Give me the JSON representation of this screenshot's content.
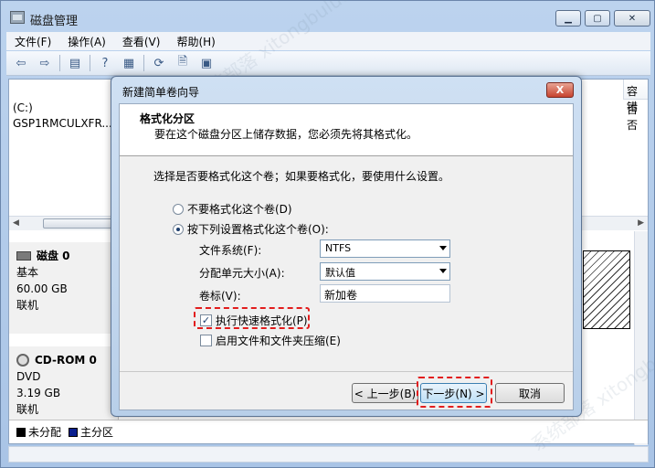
{
  "window": {
    "title": "磁盘管理"
  },
  "menu": [
    "文件(F)",
    "操作(A)",
    "查看(V)",
    "帮助(H)"
  ],
  "volume_table": {
    "rows": [
      "(C:)",
      "GSP1RMCULXFR..."
    ],
    "capacity_header": "容错",
    "capacity_values": [
      "否",
      "否"
    ]
  },
  "disks": [
    {
      "name": "磁盘 0",
      "type": "基本",
      "size": "60.00 GB",
      "status": "联机"
    },
    {
      "name": "CD-ROM 0",
      "type": "DVD",
      "size": "3.19 GB",
      "status": "联机"
    }
  ],
  "legend": [
    {
      "label": "未分配",
      "color": "#000000"
    },
    {
      "label": "主分区",
      "color": "#0a1f8f"
    }
  ],
  "dialog": {
    "title": "新建简单卷向导",
    "close_label": "X",
    "header_title": "格式化分区",
    "header_sub": "要在这个磁盘分区上储存数据，您必须先将其格式化。",
    "question": "选择是否要格式化这个卷；如果要格式化，要使用什么设置。",
    "radio_no_format": "不要格式化这个卷(D)",
    "radio_format": "按下列设置格式化这个卷(O):",
    "fs_label": "文件系统(F):",
    "fs_value": "NTFS",
    "alloc_label": "分配单元大小(A):",
    "alloc_value": "默认值",
    "vol_label": "卷标(V):",
    "vol_value": "新加卷",
    "quick_format": "执行快速格式化(P)",
    "compress": "启用文件和文件夹压缩(E)",
    "back_button": "< 上一步(B)",
    "next_button": "下一步(N) >",
    "cancel_button": "取消"
  }
}
